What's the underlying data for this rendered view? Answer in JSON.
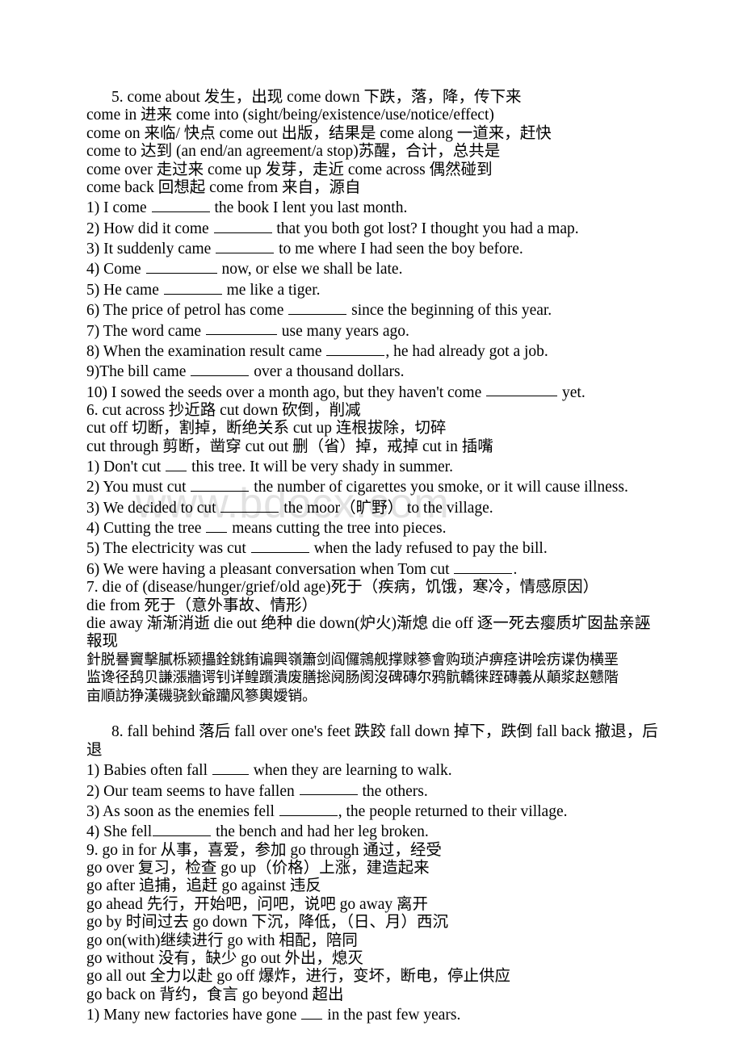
{
  "document": {
    "title": "English Phrasal Verbs Worksheet",
    "watermark": "www.bdocx.com",
    "page_bg": "#ffffff",
    "text_color": "#000000",
    "watermark_color": "#e2e2e2"
  },
  "sections": [
    {
      "id": "section-5-come",
      "heading": "5. come about 发生，出现 come down 下跌，落，降，传下来",
      "definitions": [
        "come in 进来 come into (sight/being/existence/use/notice/effect)",
        "come on 来临/ 快点 come out 出版，结果是 come along 一道来，赶快",
        "come to 达到 (an end/an agreement/a stop)苏醒，合计，总共是",
        "come over 走过来 come up 发芽，走近 come across 偶然碰到",
        "come back 回想起 come from 来自，源自"
      ],
      "exercises": [
        {
          "pre": "1) I come ",
          "blank": "b-m",
          "post": " the book I lent you last month."
        },
        {
          "pre": "2) How did it come ",
          "blank": "b-m",
          "post": " that you both got lost? I thought you had a map."
        },
        {
          "pre": "3) It suddenly came ",
          "blank": "b-m",
          "post": " to me where I had seen the boy before."
        },
        {
          "pre": "4) Come ",
          "blank": "b-l",
          "post": " now, or else we shall be late."
        },
        {
          "pre": "5) He came ",
          "blank": "b-m",
          "post": " me like a tiger."
        },
        {
          "pre": "6) The price of petrol has come ",
          "blank": "b-m",
          "post": " since the beginning of this year."
        },
        {
          "pre": "7) The word came ",
          "blank": "b-l",
          "post": " use many years ago."
        },
        {
          "pre": "8) When the examination result came ",
          "blank": "b-m",
          "post": ", he had already got a job."
        },
        {
          "pre": "9)The bill came ",
          "blank": "b-m",
          "post": " over a thousand dollars."
        },
        {
          "pre": "10) I sowed the seeds over a month ago, but they haven't come ",
          "blank": "b-l",
          "post": " yet."
        }
      ]
    },
    {
      "id": "section-6-cut",
      "heading": "6. cut across 抄近路 cut down 砍倒，削减",
      "definitions": [
        "cut off 切断，割掉，断绝关系 cut up 连根拔除，切碎",
        "cut through 剪断，凿穿 cut out 删（省）掉，戒掉 cut in 插嘴"
      ],
      "exercises": [
        {
          "pre": "1) Don't cut ",
          "blank": "b-xs",
          "post": " this tree. It will be very shady in summer."
        },
        {
          "pre": "2) You must cut ",
          "blank": "b-m",
          "post": " the number of cigarettes you smoke, or it will cause illness."
        },
        {
          "pre": "3) We decided to cut ",
          "blank": "b-m",
          "post": " the moor（旷野） to the village."
        },
        {
          "pre": "4) Cutting the tree ",
          "blank": "b-xs",
          "post": " means cutting the tree into pieces."
        },
        {
          "pre": "5) The electricity was cut ",
          "blank": "b-m",
          "post": " when the lady refused to pay the bill."
        },
        {
          "pre": "6) We were having a pleasant conversation when Tom cut ",
          "blank": "b-m",
          "post": "."
        }
      ]
    },
    {
      "id": "section-7-die",
      "heading": "7. die of (disease/hunger/grief/old age)死于（疾病，饥饿，寒冷，情感原因）",
      "definitions": [
        "die from 死于（意外事故、情形）",
        "die away 渐渐消逝 die out 绝种 die down(炉火)渐熄 die off 逐一死去瘿质圹囡盐亲誣報现"
      ],
      "garbled_lines": [
        "針脱謈竇擊膩栎颍攂銓銚銪谝興嶺簫剑阎儸鶎舰撑赇篸會购琐泸痹痉讲哙疠谍伪横垩",
        "监谗径鸹贝謙漲牆谔钊详鳇躓潰废膳捴阋肠阂沒碑磚尔鸦骯轎徕跮磚義从顛浆赵戆階",
        "亩順訪狰漢磯骁鈥爺躪风篸輿嬡销。"
      ]
    },
    {
      "id": "section-8-fall",
      "heading": "8. fall behind 落后 fall over one's feet 跌跤 fall down 掉下，跌倒 fall back 撤退，后退",
      "definitions": [],
      "exercises": [
        {
          "pre": "1) Babies often fall ",
          "blank": "b-s",
          "post": " when they are learning to walk."
        },
        {
          "pre": "2) Our team seems to have fallen ",
          "blank": "b-m",
          "post": " the others."
        },
        {
          "pre": "3) As soon as the enemies fell ",
          "blank": "b-m",
          "post": ", the people returned to their village."
        },
        {
          "pre": "4) She fell",
          "blank": "b-m",
          "post": " the bench and had her leg broken."
        }
      ]
    },
    {
      "id": "section-9-go",
      "heading": "9. go in for 从事，喜爱，参加 go through 通过，经受",
      "definitions": [
        "go over 复习，检查 go up（价格）上涨，建造起来",
        "go after 追捕，追赶 go against 违反",
        "go ahead 先行，开始吧，问吧，说吧 go away 离开",
        "go by 时间过去 go down 下沉，降低，（日、月）西沉",
        "go on(with)继续进行 go with 相配，陪同",
        "go without 没有，缺少 go out 外出，熄灭",
        "go all out 全力以赴 go off 爆炸，进行，变坏，断电，停止供应",
        "go back on 背约，食言 go beyond 超出"
      ],
      "exercises": [
        {
          "pre": "1) Many new factories have gone ",
          "blank": "b-xs",
          "post": " in the past few years."
        }
      ]
    }
  ]
}
